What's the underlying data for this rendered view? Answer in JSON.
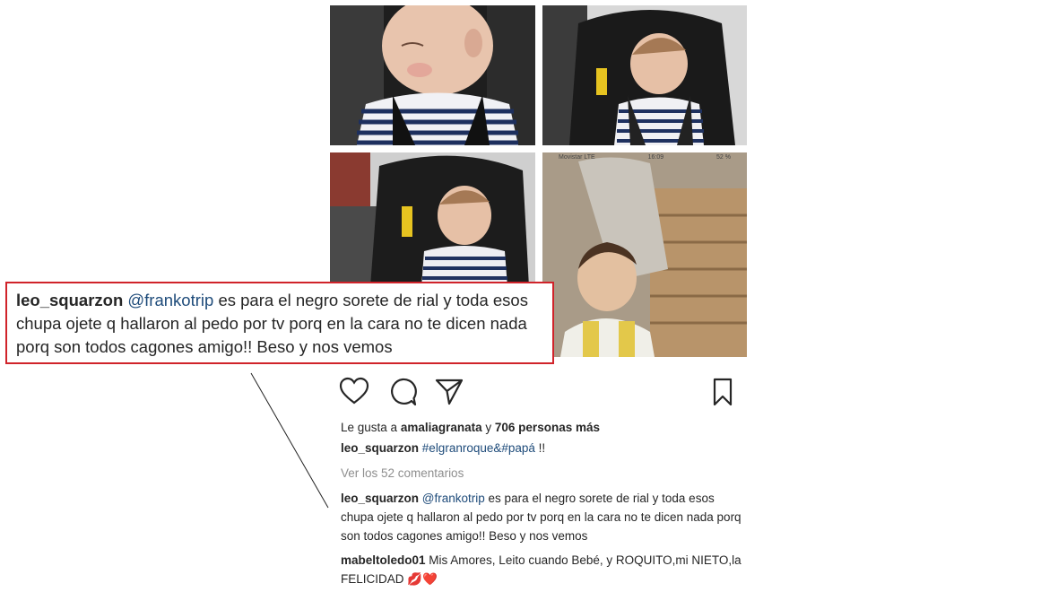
{
  "post": {
    "likes": {
      "prefix": "Le gusta a",
      "user": "amaliagranata",
      "joiner": "y",
      "count_text": "706 personas más"
    },
    "caption": {
      "user": "leo_squarzon",
      "hashtags": "#elgranroque&#papá",
      "suffix": "!!"
    },
    "view_comments": "Ver los 52 comentarios",
    "comment1": {
      "user": "leo_squarzon",
      "mention": "@frankotrip",
      "text": "es para el negro sorete de rial y toda esos chupa ojete q hallaron al pedo por tv porq en la cara no te dicen nada porq son todos cagones amigo!! Beso y nos vemos"
    },
    "comment2": {
      "user": "mabeltoledo01",
      "text": "Mis Amores, Leito cuando Bebé, y ROQUITO,mi NIETO,la FELICIDAD",
      "emoji": "💋❤️"
    },
    "photo4_statusbar": {
      "carrier": "Movistar LTE",
      "time": "16:09",
      "battery": "52 %"
    }
  },
  "zoom": {
    "user": "leo_squarzon",
    "mention": "@frankotrip",
    "text": "es para el negro sorete de rial y toda esos chupa ojete q hallaron al pedo por tv porq en la cara no te dicen nada porq son todos cagones amigo!! Beso y nos vemos"
  },
  "colors": {
    "highlight_border": "#d0232a",
    "link": "#1e4b7a",
    "muted": "#8e8e8e"
  }
}
